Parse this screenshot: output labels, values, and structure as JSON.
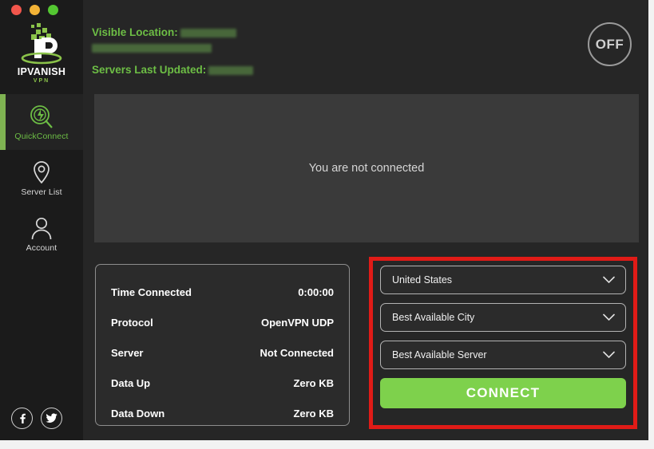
{
  "window": {
    "traffic_lights": [
      {
        "name": "close-button",
        "color": "#f2564c"
      },
      {
        "name": "minimize-button",
        "color": "#f3b336"
      },
      {
        "name": "maximize-button",
        "color": "#54c732"
      }
    ]
  },
  "brand": {
    "name": "IPVANISH",
    "name_part1": "IP",
    "name_part2": "VANISH",
    "sub": "VPN"
  },
  "sidebar": {
    "items": [
      {
        "label": "QuickConnect",
        "icon": "quickconnect-icon",
        "active": true
      },
      {
        "label": "Server List",
        "icon": "map-pin-icon",
        "active": false
      },
      {
        "label": "Account",
        "icon": "user-icon",
        "active": false
      }
    ],
    "social": [
      {
        "label": "Facebook",
        "icon": "facebook-icon"
      },
      {
        "label": "Twitter",
        "icon": "twitter-icon"
      }
    ]
  },
  "header": {
    "visible_location_label": "Visible Location:",
    "visible_location_value": "",
    "visible_location_value_line2": "",
    "servers_updated_label": "Servers Last Updated:",
    "servers_updated_value": "",
    "power_toggle_label": "OFF"
  },
  "status": {
    "message": "You are not connected"
  },
  "stats": {
    "rows": [
      {
        "label": "Time Connected",
        "value": "0:00:00"
      },
      {
        "label": "Protocol",
        "value": "OpenVPN UDP"
      },
      {
        "label": "Server",
        "value": "Not Connected"
      },
      {
        "label": "Data Up",
        "value": "Zero KB"
      },
      {
        "label": "Data Down",
        "value": "Zero KB"
      }
    ]
  },
  "connect_group": {
    "country_select": "United States",
    "city_select": "Best Available City",
    "server_select": "Best Available Server",
    "connect_label": "CONNECT",
    "highlight_color": "#e01b17"
  },
  "colors": {
    "accent_green": "#6dbe45",
    "connect_green": "#7ed14c",
    "window_bg": "#262626",
    "sidebar_bg": "#1b1b1b",
    "panel_bg": "#3a3a3a",
    "card_bg": "#2b2b2b"
  }
}
